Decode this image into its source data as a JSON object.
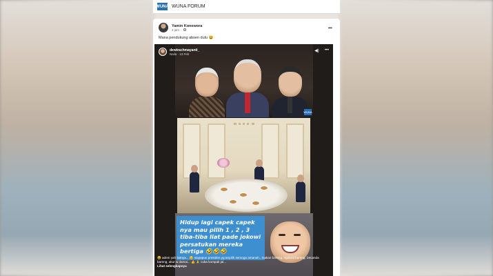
{
  "group": {
    "logo_text": "WUNA",
    "name": "WUNA FORUM"
  },
  "post": {
    "author": "Yamin Konewora",
    "time": "4 jam",
    "caption": "Mana pendukung absen dulu 😆"
  },
  "video": {
    "user": "dewirachmayanti_",
    "sub": "Naila · 13 Feb",
    "overlay_text": "Hidup lagi capek capek nya mau pilih 1 , 2 , 3 tiba-tiba liat pade jokowi persatukan mereka bertiga 🤣🤣🤣",
    "caption_text": "😆 adem yah liatnya... 😊 siapapun presiden yg terpilih semoga amanah.. makan bareng, ngobrol bareng, becanda bareng, akur & damai... 👍 🙏 cuba kompak jal...",
    "see_more": "Lihat selengkapnya",
    "corner_badge": "WUNA"
  },
  "icons": [
    "globe-icon",
    "more-icon",
    "volume-icon"
  ]
}
